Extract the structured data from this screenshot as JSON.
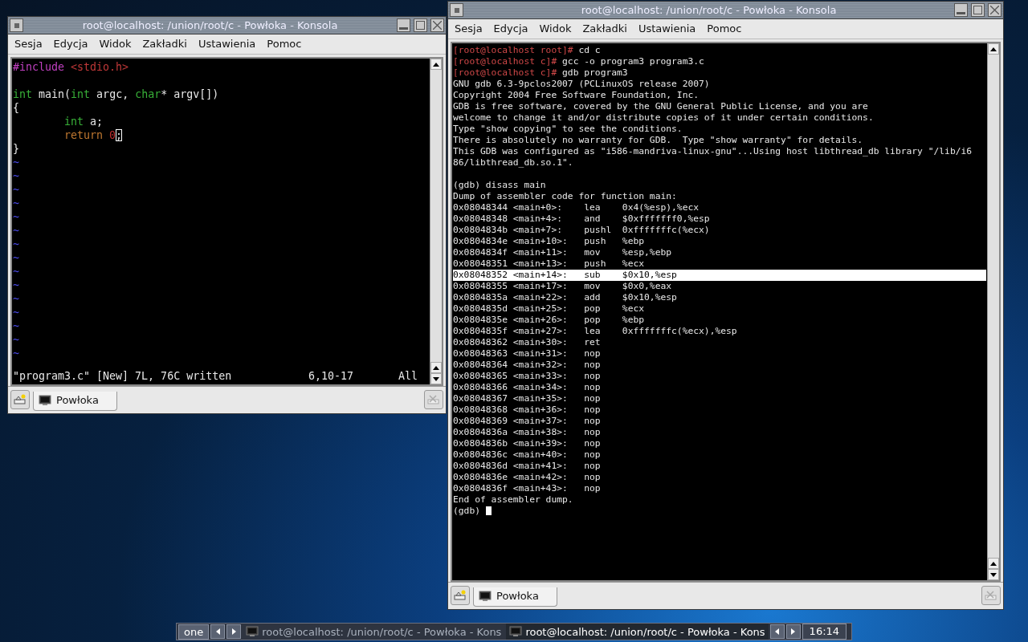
{
  "windows": [
    {
      "title": "root@localhost: /union/root/c - Powłoka - Konsola",
      "menu": [
        "Sesja",
        "Edycja",
        "Widok",
        "Zakładki",
        "Ustawienia",
        "Pomoc"
      ],
      "terminal": {
        "lines": [
          {
            "kind": "text",
            "segments": [
              {
                "text": "#include ",
                "kind": "preproc"
              },
              {
                "text": "<stdio.h>",
                "kind": "string"
              }
            ]
          },
          {
            "kind": "blank"
          },
          {
            "kind": "text",
            "segments": [
              {
                "text": "int",
                "kind": "type"
              },
              {
                "text": " main(",
                "kind": "normal"
              },
              {
                "text": "int",
                "kind": "type"
              },
              {
                "text": " argc, ",
                "kind": "normal"
              },
              {
                "text": "char",
                "kind": "type"
              },
              {
                "text": "* argv[])",
                "kind": "normal"
              }
            ]
          },
          {
            "kind": "text",
            "segments": [
              {
                "text": "{",
                "kind": "normal"
              }
            ]
          },
          {
            "kind": "text",
            "segments": [
              {
                "text": "        int",
                "kind": "type"
              },
              {
                "text": " a;",
                "kind": "normal"
              }
            ]
          },
          {
            "kind": "text",
            "segments": [
              {
                "text": "        return ",
                "kind": "statement"
              },
              {
                "text": "0",
                "kind": "number"
              },
              {
                "text": ";",
                "kind": "cursor"
              }
            ]
          },
          {
            "kind": "text",
            "segments": [
              {
                "text": "}",
                "kind": "normal"
              }
            ]
          },
          {
            "kind": "text",
            "segments": [
              {
                "text": "~",
                "kind": "tilde"
              }
            ]
          },
          {
            "kind": "text",
            "segments": [
              {
                "text": "~",
                "kind": "tilde"
              }
            ]
          },
          {
            "kind": "text",
            "segments": [
              {
                "text": "~",
                "kind": "tilde"
              }
            ]
          },
          {
            "kind": "text",
            "segments": [
              {
                "text": "~",
                "kind": "tilde"
              }
            ]
          },
          {
            "kind": "text",
            "segments": [
              {
                "text": "~",
                "kind": "tilde"
              }
            ]
          },
          {
            "kind": "text",
            "segments": [
              {
                "text": "~",
                "kind": "tilde"
              }
            ]
          },
          {
            "kind": "text",
            "segments": [
              {
                "text": "~",
                "kind": "tilde"
              }
            ]
          },
          {
            "kind": "text",
            "segments": [
              {
                "text": "~",
                "kind": "tilde"
              }
            ]
          },
          {
            "kind": "text",
            "segments": [
              {
                "text": "~",
                "kind": "tilde"
              }
            ]
          },
          {
            "kind": "text",
            "segments": [
              {
                "text": "~",
                "kind": "tilde"
              }
            ]
          },
          {
            "kind": "text",
            "segments": [
              {
                "text": "~",
                "kind": "tilde"
              }
            ]
          },
          {
            "kind": "text",
            "segments": [
              {
                "text": "~",
                "kind": "tilde"
              }
            ]
          },
          {
            "kind": "text",
            "segments": [
              {
                "text": "~",
                "kind": "tilde"
              }
            ]
          },
          {
            "kind": "text",
            "segments": [
              {
                "text": "~",
                "kind": "tilde"
              }
            ]
          },
          {
            "kind": "text",
            "segments": [
              {
                "text": "~",
                "kind": "tilde"
              }
            ]
          }
        ],
        "status": {
          "message": "\"program3.c\" [New] 7L, 76C written",
          "position": "6,10-17",
          "scroll": "All"
        }
      },
      "tabs": [
        {
          "label": "Powłoka",
          "selected": true
        }
      ]
    },
    {
      "title": "root@localhost: /union/root/c - Powłoka - Konsola",
      "menu": [
        "Sesja",
        "Edycja",
        "Widok",
        "Zakładki",
        "Ustawienia",
        "Pomoc"
      ],
      "terminal": {
        "lines": [
          {
            "kind": "text",
            "selected": false,
            "segments": [
              {
                "text": "[root@localhost root]#",
                "kind": "prompt"
              },
              {
                "text": " cd c",
                "kind": "normal"
              }
            ]
          },
          {
            "kind": "text",
            "selected": false,
            "segments": [
              {
                "text": "[root@localhost c]#",
                "kind": "prompt"
              },
              {
                "text": " gcc -o program3 program3.c",
                "kind": "normal"
              }
            ]
          },
          {
            "kind": "text",
            "selected": false,
            "segments": [
              {
                "text": "[root@localhost c]#",
                "kind": "prompt"
              },
              {
                "text": " gdb program3",
                "kind": "normal"
              }
            ]
          },
          {
            "kind": "text",
            "selected": false,
            "segments": [
              {
                "text": "GNU gdb 6.3-9pclos2007 (PCLinuxOS release 2007)",
                "kind": "normal"
              }
            ]
          },
          {
            "kind": "text",
            "selected": false,
            "segments": [
              {
                "text": "Copyright 2004 Free Software Foundation, Inc.",
                "kind": "normal"
              }
            ]
          },
          {
            "kind": "text",
            "selected": false,
            "segments": [
              {
                "text": "GDB is free software, covered by the GNU General Public License, and you are",
                "kind": "normal"
              }
            ]
          },
          {
            "kind": "text",
            "selected": false,
            "segments": [
              {
                "text": "welcome to change it and/or distribute copies of it under certain conditions.",
                "kind": "normal"
              }
            ]
          },
          {
            "kind": "text",
            "selected": false,
            "segments": [
              {
                "text": "Type \"show copying\" to see the conditions.",
                "kind": "normal"
              }
            ]
          },
          {
            "kind": "text",
            "selected": false,
            "segments": [
              {
                "text": "There is absolutely no warranty for GDB.  Type \"show warranty\" for details.",
                "kind": "normal"
              }
            ]
          },
          {
            "kind": "text",
            "selected": false,
            "segments": [
              {
                "text": "This GDB was configured as \"i586-mandriva-linux-gnu\"...Using host libthread_db library \"/lib/i6",
                "kind": "normal"
              }
            ]
          },
          {
            "kind": "text",
            "selected": false,
            "segments": [
              {
                "text": "86/libthread_db.so.1\".",
                "kind": "normal"
              }
            ]
          },
          {
            "kind": "blank",
            "selected": false
          },
          {
            "kind": "text",
            "selected": false,
            "segments": [
              {
                "text": "(gdb) disass main",
                "kind": "normal"
              }
            ]
          },
          {
            "kind": "text",
            "selected": false,
            "segments": [
              {
                "text": "Dump of assembler code for function main:",
                "kind": "normal"
              }
            ]
          },
          {
            "kind": "text",
            "selected": false,
            "segments": [
              {
                "text": "0x08048344 <main+0>:    lea    0x4(%esp),%ecx",
                "kind": "normal"
              }
            ]
          },
          {
            "kind": "text",
            "selected": false,
            "segments": [
              {
                "text": "0x08048348 <main+4>:    and    $0xfffffff0,%esp",
                "kind": "normal"
              }
            ]
          },
          {
            "kind": "text",
            "selected": false,
            "segments": [
              {
                "text": "0x0804834b <main+7>:    pushl  0xfffffffc(%ecx)",
                "kind": "normal"
              }
            ]
          },
          {
            "kind": "text",
            "selected": false,
            "segments": [
              {
                "text": "0x0804834e <main+10>:   push   %ebp",
                "kind": "normal"
              }
            ]
          },
          {
            "kind": "text",
            "selected": false,
            "segments": [
              {
                "text": "0x0804834f <main+11>:   mov    %esp,%ebp",
                "kind": "normal"
              }
            ]
          },
          {
            "kind": "text",
            "selected": false,
            "segments": [
              {
                "text": "0x08048351 <main+13>:   push   %ecx",
                "kind": "normal"
              }
            ]
          },
          {
            "kind": "text",
            "selected": true,
            "segments": [
              {
                "text": "0x08048352 <main+14>:   sub    $0x10,%esp",
                "kind": "normal"
              }
            ]
          },
          {
            "kind": "text",
            "selected": false,
            "segments": [
              {
                "text": "0x08048355 <main+17>:   mov    $0x0,%eax",
                "kind": "normal"
              }
            ]
          },
          {
            "kind": "text",
            "selected": false,
            "segments": [
              {
                "text": "0x0804835a <main+22>:   add    $0x10,%esp",
                "kind": "normal"
              }
            ]
          },
          {
            "kind": "text",
            "selected": false,
            "segments": [
              {
                "text": "0x0804835d <main+25>:   pop    %ecx",
                "kind": "normal"
              }
            ]
          },
          {
            "kind": "text",
            "selected": false,
            "segments": [
              {
                "text": "0x0804835e <main+26>:   pop    %ebp",
                "kind": "normal"
              }
            ]
          },
          {
            "kind": "text",
            "selected": false,
            "segments": [
              {
                "text": "0x0804835f <main+27>:   lea    0xfffffffc(%ecx),%esp",
                "kind": "normal"
              }
            ]
          },
          {
            "kind": "text",
            "selected": false,
            "segments": [
              {
                "text": "0x08048362 <main+30>:   ret",
                "kind": "normal"
              }
            ]
          },
          {
            "kind": "text",
            "selected": false,
            "segments": [
              {
                "text": "0x08048363 <main+31>:   nop",
                "kind": "normal"
              }
            ]
          },
          {
            "kind": "text",
            "selected": false,
            "segments": [
              {
                "text": "0x08048364 <main+32>:   nop",
                "kind": "normal"
              }
            ]
          },
          {
            "kind": "text",
            "selected": false,
            "segments": [
              {
                "text": "0x08048365 <main+33>:   nop",
                "kind": "normal"
              }
            ]
          },
          {
            "kind": "text",
            "selected": false,
            "segments": [
              {
                "text": "0x08048366 <main+34>:   nop",
                "kind": "normal"
              }
            ]
          },
          {
            "kind": "text",
            "selected": false,
            "segments": [
              {
                "text": "0x08048367 <main+35>:   nop",
                "kind": "normal"
              }
            ]
          },
          {
            "kind": "text",
            "selected": false,
            "segments": [
              {
                "text": "0x08048368 <main+36>:   nop",
                "kind": "normal"
              }
            ]
          },
          {
            "kind": "text",
            "selected": false,
            "segments": [
              {
                "text": "0x08048369 <main+37>:   nop",
                "kind": "normal"
              }
            ]
          },
          {
            "kind": "text",
            "selected": false,
            "segments": [
              {
                "text": "0x0804836a <main+38>:   nop",
                "kind": "normal"
              }
            ]
          },
          {
            "kind": "text",
            "selected": false,
            "segments": [
              {
                "text": "0x0804836b <main+39>:   nop",
                "kind": "normal"
              }
            ]
          },
          {
            "kind": "text",
            "selected": false,
            "segments": [
              {
                "text": "0x0804836c <main+40>:   nop",
                "kind": "normal"
              }
            ]
          },
          {
            "kind": "text",
            "selected": false,
            "segments": [
              {
                "text": "0x0804836d <main+41>:   nop",
                "kind": "normal"
              }
            ]
          },
          {
            "kind": "text",
            "selected": false,
            "segments": [
              {
                "text": "0x0804836e <main+42>:   nop",
                "kind": "normal"
              }
            ]
          },
          {
            "kind": "text",
            "selected": false,
            "segments": [
              {
                "text": "0x0804836f <main+43>:   nop",
                "kind": "normal"
              }
            ]
          },
          {
            "kind": "text",
            "selected": false,
            "segments": [
              {
                "text": "End of assembler dump.",
                "kind": "normal"
              }
            ]
          },
          {
            "kind": "text",
            "selected": false,
            "cursor": true,
            "segments": [
              {
                "text": "(gdb)",
                "kind": "normal"
              }
            ]
          }
        ]
      },
      "tabs": [
        {
          "label": "Powłoka",
          "selected": true
        }
      ]
    }
  ],
  "taskbar": {
    "desktop": "one",
    "tasks": [
      {
        "label": "root@localhost: /union/root/c - Powłoka - Kons",
        "selected": false
      },
      {
        "label": "root@localhost: /union/root/c - Powłoka - Kons",
        "selected": true
      }
    ],
    "clock": "16:14"
  }
}
